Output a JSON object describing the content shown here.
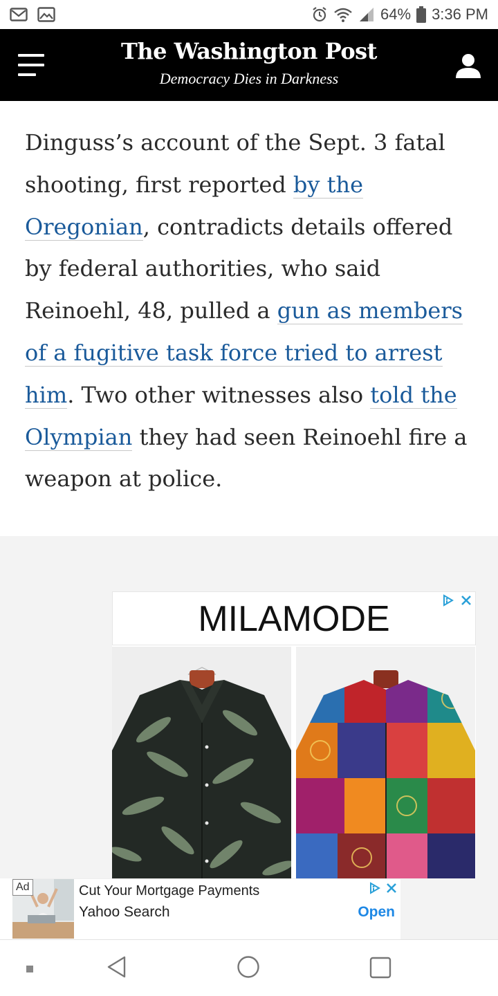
{
  "status_bar": {
    "battery_percent": "64%",
    "time": "3:36 PM",
    "left_icons": [
      "gmail-icon",
      "gallery-icon"
    ],
    "right_icons": [
      "alarm-icon",
      "wifi-icon",
      "signal-icon",
      "battery-icon"
    ]
  },
  "header": {
    "title": "The Washington Post",
    "tagline": "Democracy Dies in Darkness",
    "menu_icon": "menu-icon",
    "account_icon": "user-icon"
  },
  "article": {
    "segments": [
      {
        "text": "Dinguss’s account of the Sept. 3 fatal shooting, first reported ",
        "link": false
      },
      {
        "text": "by the Oregonian",
        "link": true
      },
      {
        "text": ", contradicts details offered by federal authorities, who said Reinoehl, 48, pulled a ",
        "link": false
      },
      {
        "text": "gun as members of a fugitive task force tried to arrest him",
        "link": true
      },
      {
        "text": ". Two other witnesses also ",
        "link": false
      },
      {
        "text": "told the Olympian",
        "link": true
      },
      {
        "text": " they had seen Reinoehl fire a weapon at police.",
        "link": false
      }
    ],
    "link_color": "#1a5a9a"
  },
  "display_ad": {
    "brand": "MILAMODE",
    "products": [
      "green-fern-print-shirt",
      "colorful-patchwork-print-shirt"
    ],
    "adchoices_icon": "adchoices-icon",
    "close_icon": "close-icon"
  },
  "banner_ad": {
    "badge": "Ad",
    "headline": "Cut Your Mortgage Payments",
    "source": "Yahoo Search",
    "cta": "Open",
    "cta_color": "#1e88e5"
  },
  "nav_bar": {
    "buttons": [
      "recents-dot",
      "back-icon",
      "home-icon",
      "overview-icon"
    ]
  }
}
